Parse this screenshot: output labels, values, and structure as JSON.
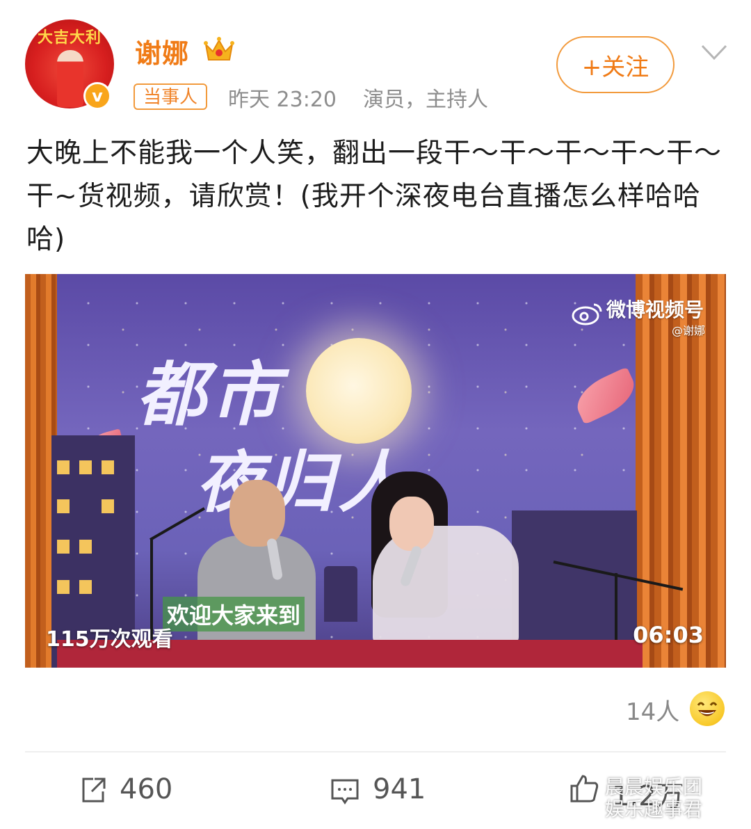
{
  "author": {
    "name": "谢娜",
    "avatar_caption": "大吉大利",
    "verified_mark": "v",
    "crown": "crown-icon"
  },
  "meta": {
    "tag": "当事人",
    "time": "昨天 23:20",
    "role": "演员，主持人"
  },
  "follow_label": "+关注",
  "post_text": "大晚上不能我一个人笑，翻出一段干～干～干～干～干～干~货视频，请欣赏！(我开个深夜电台直播怎么样哈哈哈)",
  "video": {
    "watermark": "微博视频号",
    "watermark_handle": "@谢娜",
    "show_title_line1": "都市",
    "show_title_line2": "夜归人",
    "subtitle": "欢迎大家来到",
    "views": "115万次观看",
    "duration": "06:03"
  },
  "reactions": {
    "count": "14人",
    "emoji": "laughing-emoji"
  },
  "actions": {
    "repost": "460",
    "comment": "941",
    "like": "1.2万"
  },
  "corner_watermark": {
    "line1": "晨晨娱乐团",
    "line2": "娱乐趣事君"
  },
  "colors": {
    "accent": "#f07b16",
    "meta_gray": "#8d8d8d"
  }
}
